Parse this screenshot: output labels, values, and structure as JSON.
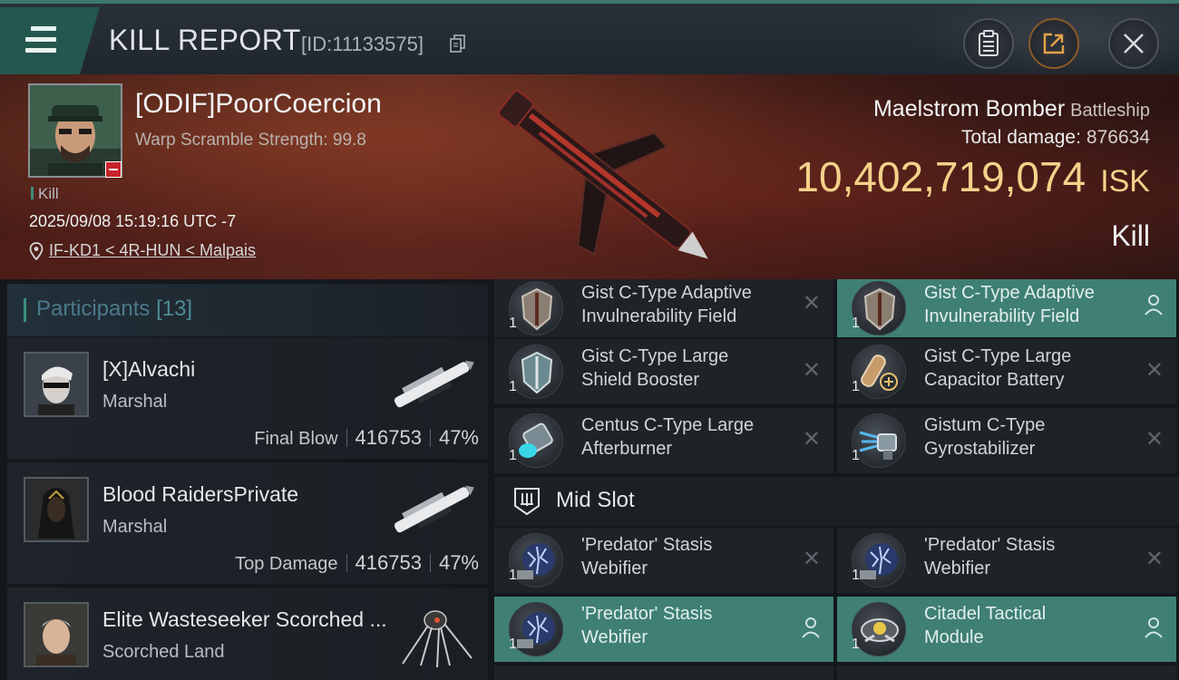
{
  "header": {
    "title": "KILL REPORT",
    "id_text": "[ID:11133575]"
  },
  "victim": {
    "name": "[ODIF]PoorCoercion",
    "subtitle": "Warp Scramble Strength: 99.8",
    "result_tag": "Kill",
    "datetime": "2025/09/08 15:19:16 UTC -7",
    "location": "IF-KD1 < 4R-HUN < Malpais"
  },
  "ship": {
    "name": "Maelstrom Bomber",
    "class": "Battleship",
    "damage_label": "Total damage:",
    "damage_value": "876634",
    "isk_value": "10,402,719,074",
    "isk_unit": "ISK",
    "result": "Kill"
  },
  "participants": {
    "label": "Participants",
    "count": "[13]",
    "rows": [
      {
        "name": "[X]Alvachi",
        "ship": "Marshal",
        "tag": "Final Blow",
        "damage": "416753",
        "percent": "47%"
      },
      {
        "name": "Blood RaidersPrivate",
        "ship": "Marshal",
        "tag": "Top Damage",
        "damage": "416753",
        "percent": "47%"
      },
      {
        "name": "Elite Wasteseeker Scorched ...",
        "ship": "Scorched Land"
      }
    ]
  },
  "modules": {
    "top": [
      {
        "name_line1": "Gist C-Type Adaptive",
        "name_line2": "Invulnerability Field",
        "qty": "1"
      },
      {
        "name_line1": "Gist C-Type Adaptive",
        "name_line2": "Invulnerability Field",
        "qty": "1"
      },
      {
        "name_line1": "Gist C-Type Large",
        "name_line2": "Shield Booster",
        "qty": "1"
      },
      {
        "name_line1": "Gist C-Type Large",
        "name_line2": "Capacitor Battery",
        "qty": "1"
      },
      {
        "name_line1": "Centus C-Type Large",
        "name_line2": "Afterburner",
        "qty": "1"
      },
      {
        "name_line1": "Gistum C-Type",
        "name_line2": "Gyrostabilizer",
        "qty": "1"
      }
    ],
    "mid_slot_label": "Mid Slot",
    "mid": [
      {
        "name_line1": "'Predator' Stasis",
        "name_line2": "Webifier",
        "qty": "1"
      },
      {
        "name_line1": "'Predator' Stasis",
        "name_line2": "Webifier",
        "qty": "1"
      },
      {
        "name_line1": "'Predator' Stasis",
        "name_line2": "Webifier",
        "qty": "1"
      },
      {
        "name_line1": "Citadel Tactical",
        "name_line2": "Module",
        "qty": "1"
      }
    ]
  },
  "colors": {
    "accent_teal": "#3f7f74",
    "isk_gold": "#f4d28a",
    "kill_red": "#c8232a"
  }
}
